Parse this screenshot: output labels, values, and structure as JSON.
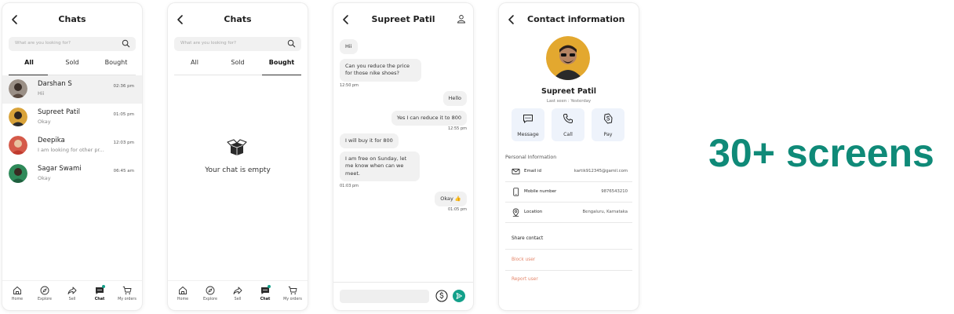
{
  "colors": {
    "accent": "#13a08a",
    "promo_text": "#0f8a78",
    "danger": "#e4866a",
    "action_tile": "#eef3fb"
  },
  "promo": {
    "text": "30+ screens"
  },
  "screen1": {
    "title": "Chats",
    "search_placeholder": "What are you looking for?",
    "tabs": [
      "All",
      "Sold",
      "Bought"
    ],
    "active_tab": "All",
    "chats": [
      {
        "name": "Darshan S",
        "message": "Hii",
        "time": "02:36 pm",
        "selected": true
      },
      {
        "name": "Supreet Patil",
        "message": "Okay",
        "time": "01:05 pm",
        "selected": false
      },
      {
        "name": "Deepika",
        "message": "I am looking for other pr...",
        "time": "12:03 pm",
        "selected": false
      },
      {
        "name": "Sagar Swami",
        "message": "Okay",
        "time": "06:45 am",
        "selected": false
      }
    ]
  },
  "nav": {
    "items": [
      {
        "label": "Home",
        "icon": "home-icon"
      },
      {
        "label": "Explore",
        "icon": "compass-icon"
      },
      {
        "label": "Sell",
        "icon": "share-icon"
      },
      {
        "label": "Chat",
        "icon": "chat-icon"
      },
      {
        "label": "My orders",
        "icon": "cart-icon"
      }
    ],
    "active": "Chat"
  },
  "screen2": {
    "title": "Chats",
    "search_placeholder": "What are you looking for?",
    "tabs": [
      "All",
      "Sold",
      "Bought"
    ],
    "active_tab": "Bought",
    "empty_text": "Your chat is empty"
  },
  "screen3": {
    "title": "Supreet Patil",
    "messages": [
      {
        "text": "Hii",
        "side": "left"
      },
      {
        "text": "Can you reduce the price for those nike shoes?",
        "side": "left",
        "time": "12:50 pm"
      },
      {
        "text": "Hello",
        "side": "right"
      },
      {
        "text": "Yes I can reduce it to 800",
        "side": "right",
        "time": "12:55 pm"
      },
      {
        "text": "I will buy it for 800",
        "side": "left"
      },
      {
        "text": "I am free on Sunday, let me know when can we meet.",
        "side": "left",
        "time": "01:03 pm"
      },
      {
        "text": "Okay 👍",
        "side": "right",
        "time": "01:05 pm"
      }
    ]
  },
  "screen4": {
    "title": "Contact information",
    "name": "Supreet Patil",
    "last_seen": "Last seen : Yesterday",
    "actions": [
      {
        "label": "Message",
        "icon": "message-icon"
      },
      {
        "label": "Call",
        "icon": "phone-icon"
      },
      {
        "label": "Pay",
        "icon": "pay-icon"
      }
    ],
    "section_title": "Personal Information",
    "info": [
      {
        "label": "Email id",
        "value": "kartik912345@gamil.com",
        "icon": "mail-icon"
      },
      {
        "label": "Mobile number",
        "value": "9876543210",
        "icon": "mobile-icon"
      },
      {
        "label": "Location",
        "value": "Bengaluru, Karnataka",
        "icon": "location-icon"
      }
    ],
    "share_contact": "Share contact",
    "block_user": "Block user",
    "report_user": "Report user"
  }
}
